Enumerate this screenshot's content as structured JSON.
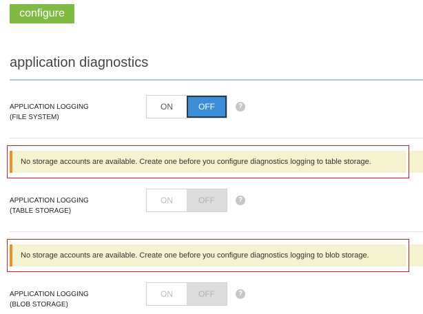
{
  "tab": {
    "label": "configure"
  },
  "section": {
    "title": "application diagnostics"
  },
  "settings": [
    {
      "label_line1": "APPLICATION LOGGING",
      "label_line2": "(FILE SYSTEM)",
      "on_label": "ON",
      "off_label": "OFF",
      "selected": "OFF",
      "enabled": true,
      "help_icon": "question-circle-icon",
      "help_glyph": "?"
    },
    {
      "notice": "No storage accounts are available. Create one before you configure diagnostics logging to table storage.",
      "label_line1": "APPLICATION LOGGING",
      "label_line2": "(TABLE STORAGE)",
      "on_label": "ON",
      "off_label": "OFF",
      "selected": "OFF",
      "enabled": false,
      "help_icon": "question-circle-icon",
      "help_glyph": "?"
    },
    {
      "notice": "No storage accounts are available. Create one before you configure diagnostics logging to blob storage.",
      "label_line1": "APPLICATION LOGGING",
      "label_line2": "(BLOB STORAGE)",
      "on_label": "ON",
      "off_label": "OFF",
      "selected": "OFF",
      "enabled": false,
      "help_icon": "question-circle-icon",
      "help_glyph": "?"
    }
  ],
  "colors": {
    "tab_green": "#7fba42",
    "toggle_active_blue": "#3c8ed8",
    "section_rule_blue": "#a9cbea",
    "notice_background": "#f5f2cf",
    "notice_accent_orange": "#e8942a",
    "highlight_red": "#cc1f1f"
  }
}
